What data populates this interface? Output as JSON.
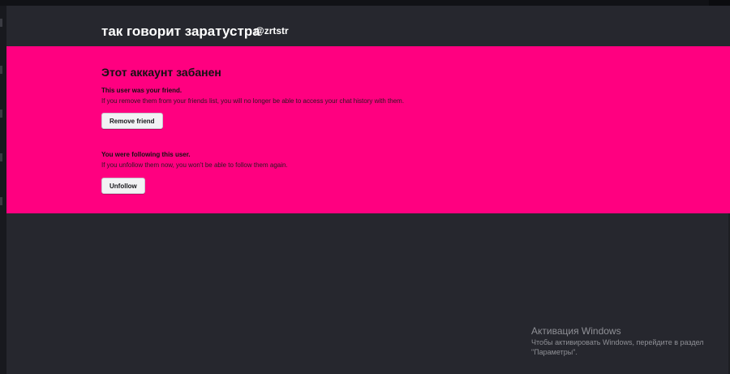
{
  "profile": {
    "display_name": "так говорит заратустра",
    "username": "@zrtstr"
  },
  "banned_panel": {
    "title": "Этот аккаунт забанен",
    "friend_section": {
      "title": "This user was your friend.",
      "description": "If you remove them from your friends list, you will no longer be able to access your chat history with them.",
      "button_label": "Remove friend"
    },
    "follow_section": {
      "title": "You were following this user.",
      "description": "If you unfollow them now, you won't be able to follow them again.",
      "button_label": "Unfollow"
    }
  },
  "os_watermark": {
    "title": "Активация Windows",
    "line1": "Чтобы активировать Windows, перейдите в раздел",
    "line2": "\"Параметры\"."
  },
  "colors": {
    "panel_background": "#ff0080",
    "page_background": "#26272e",
    "button_background": "#f2f2f4"
  }
}
